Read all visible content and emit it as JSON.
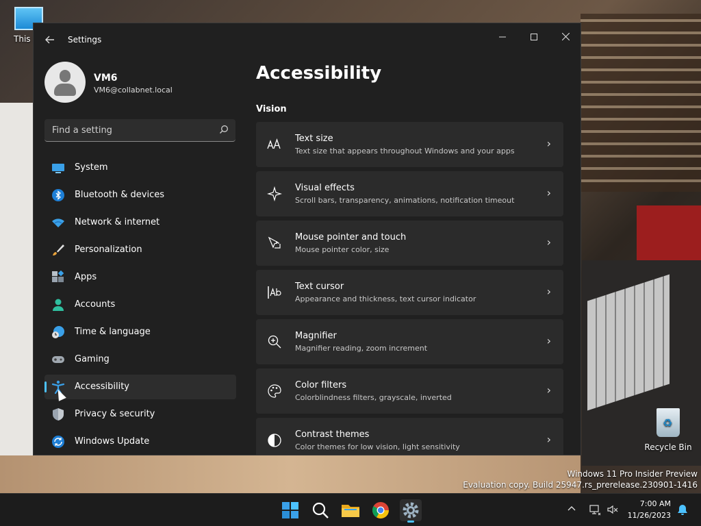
{
  "desktop": {
    "thispc_label": "This PC",
    "recycle_label": "Recycle Bin",
    "watermark_line1": "Windows 11 Pro Insider Preview",
    "watermark_line2": "Evaluation copy. Build 25947.rs_prerelease.230901-1416"
  },
  "window": {
    "title": "Settings",
    "back_icon": "back-arrow-icon",
    "controls": [
      "minimize",
      "maximize",
      "close"
    ]
  },
  "profile": {
    "name": "VM6",
    "email": "VM6@collabnet.local"
  },
  "search": {
    "placeholder": "Find a setting"
  },
  "nav": {
    "items": [
      {
        "label": "System",
        "icon": "system-icon"
      },
      {
        "label": "Bluetooth & devices",
        "icon": "bluetooth-icon"
      },
      {
        "label": "Network & internet",
        "icon": "wifi-icon"
      },
      {
        "label": "Personalization",
        "icon": "brush-icon"
      },
      {
        "label": "Apps",
        "icon": "apps-icon"
      },
      {
        "label": "Accounts",
        "icon": "account-icon"
      },
      {
        "label": "Time & language",
        "icon": "globe-clock-icon"
      },
      {
        "label": "Gaming",
        "icon": "gamepad-icon"
      },
      {
        "label": "Accessibility",
        "icon": "accessibility-icon",
        "active": true
      },
      {
        "label": "Privacy & security",
        "icon": "shield-icon"
      },
      {
        "label": "Windows Update",
        "icon": "update-icon"
      }
    ]
  },
  "main": {
    "title": "Accessibility",
    "section": "Vision",
    "cards": [
      {
        "title": "Text size",
        "subtitle": "Text size that appears throughout Windows and your apps",
        "icon": "text-size-icon"
      },
      {
        "title": "Visual effects",
        "subtitle": "Scroll bars, transparency, animations, notification timeout",
        "icon": "sparkle-icon"
      },
      {
        "title": "Mouse pointer and touch",
        "subtitle": "Mouse pointer color, size",
        "icon": "pointer-touch-icon"
      },
      {
        "title": "Text cursor",
        "subtitle": "Appearance and thickness, text cursor indicator",
        "icon": "text-cursor-icon"
      },
      {
        "title": "Magnifier",
        "subtitle": "Magnifier reading, zoom increment",
        "icon": "magnifier-icon"
      },
      {
        "title": "Color filters",
        "subtitle": "Colorblindness filters, grayscale, inverted",
        "icon": "palette-icon"
      },
      {
        "title": "Contrast themes",
        "subtitle": "Color themes for low vision, light sensitivity",
        "icon": "contrast-icon"
      }
    ]
  },
  "taskbar": {
    "time": "7:00 AM",
    "date": "11/26/2023"
  },
  "colors": {
    "accent": "#4cc2ff",
    "window_bg": "#202020",
    "card_bg": "#2b2b2b"
  }
}
